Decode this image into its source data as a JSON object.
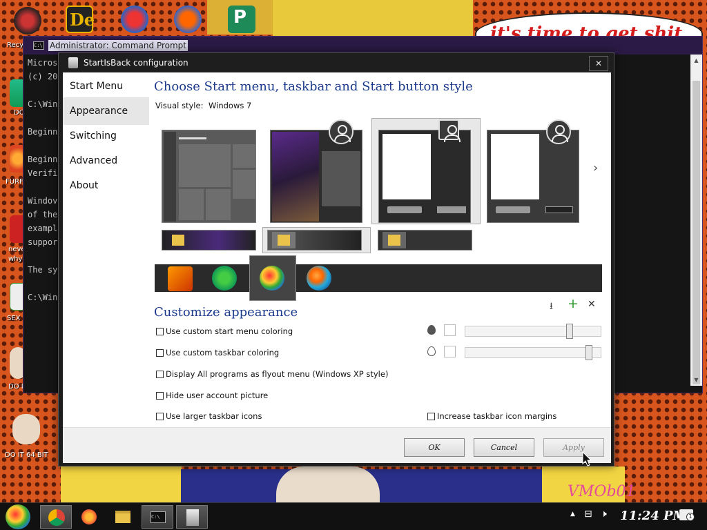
{
  "desktop": {
    "icons": [
      {
        "label": "Recy"
      },
      {
        "label": "DO"
      },
      {
        "label": "FURF"
      },
      {
        "label": "neve"
      },
      {
        "label": "why"
      },
      {
        "label": "SEX"
      },
      {
        "label": "DO I"
      },
      {
        "label": "DO IT 64 BIT"
      }
    ],
    "speech_text": "it's time to get shit",
    "signature": "VMOb01"
  },
  "cmd": {
    "title": "Administrator: Command Prompt",
    "icon_text": "C:\\",
    "lines": [
      "Micros",
      "(c) 20",
      "",
      "C:\\Win",
      "",
      "Beginn",
      "",
      "Beginn",
      "Verifi",
      "",
      "Windov",
      "of the",
      "exampl",
      "suppor",
      "",
      "The sy",
      "",
      "C:\\Win"
    ]
  },
  "dialog": {
    "title": "StartIsBack configuration",
    "close": "✕",
    "nav": [
      "Start Menu",
      "Appearance",
      "Switching",
      "Advanced",
      "About"
    ],
    "heading_style": "Choose Start menu, taskbar and Start button style",
    "visual_style_label": "Visual style:",
    "visual_style_value": "Windows 7",
    "next_arrow": "›",
    "heading_customize": "Customize appearance",
    "toolbar": {
      "download": "⭳",
      "add": "+",
      "remove": "✕"
    },
    "options": [
      "Use custom start menu coloring",
      "Use custom taskbar coloring",
      "Display All programs as flyout menu (Windows XP style)",
      "Hide user account picture",
      "Use larger taskbar icons"
    ],
    "option_right": "Increase taskbar icon margins",
    "sliders": {
      "start_menu_opacity": 0.78,
      "taskbar_opacity": 0.93
    },
    "buttons": {
      "ok": "OK",
      "cancel": "Cancel",
      "apply": "Apply"
    }
  },
  "taskbar": {
    "clock": "11:24 PM",
    "tray": [
      "▲",
      "⊟",
      "🕨"
    ],
    "notification_badge": "1"
  }
}
